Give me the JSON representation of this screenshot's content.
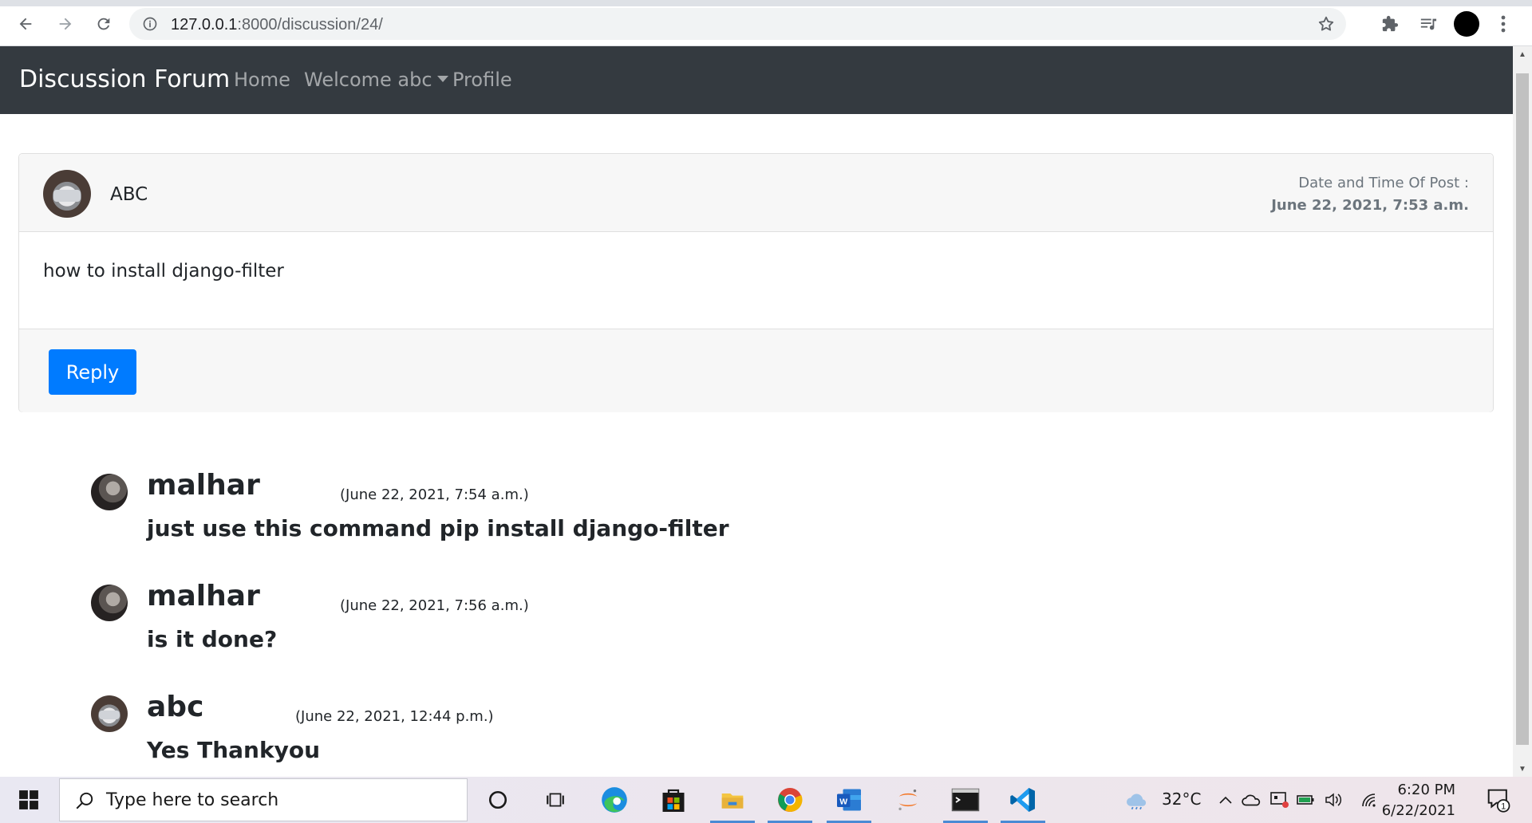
{
  "browser": {
    "url_host": "127.0.0.1",
    "url_rest": ":8000/discussion/24/"
  },
  "navbar": {
    "brand": "Discussion Forum",
    "home": "Home",
    "welcome": "Welcome abc",
    "profile": "Profile"
  },
  "post": {
    "author": "ABC",
    "date_label": "Date and Time Of Post :",
    "date": "June 22, 2021, 7:53 a.m.",
    "content": "how to install django-filter",
    "reply_label": "Reply"
  },
  "replies": [
    {
      "user": "malhar",
      "date": "(June 22, 2021, 7:54 a.m.)",
      "text": "just use this command pip install django-filter"
    },
    {
      "user": "malhar",
      "date": "(June 22, 2021, 7:56 a.m.)",
      "text": "is it done?"
    },
    {
      "user": "abc",
      "date": "(June 22, 2021, 12:44 p.m.)",
      "text": "Yes Thankyou"
    }
  ],
  "taskbar": {
    "search_placeholder": "Type here to search",
    "temperature": "32°C",
    "time": "6:20 PM",
    "date": "6/22/2021",
    "notification_count": "1"
  }
}
